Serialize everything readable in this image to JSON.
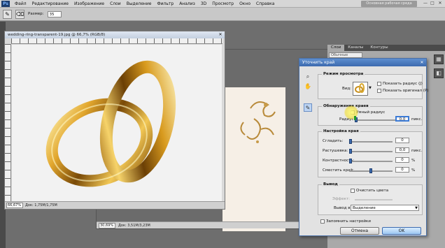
{
  "app": {
    "logo": "Ps",
    "menu": [
      "Файл",
      "Редактирование",
      "Изображение",
      "Слои",
      "Выделение",
      "Фильтр",
      "Анализ",
      "3D",
      "Просмотр",
      "Окно",
      "Справка"
    ],
    "workspace_button": "Основная рабочая среда",
    "window_controls": [
      "—",
      "□",
      "✕"
    ]
  },
  "options_bar": {
    "size_label": "Размер:",
    "size_value": "35"
  },
  "doc1": {
    "title": "wedding-ring-transparent-19.jpg @ 66,7% (RGB/8)",
    "zoom": "66,67%",
    "doc_size": "Док: 1,75M/1,75M"
  },
  "doc2": {
    "zoom": "30,69%",
    "doc_size": "Док: 3,51M/3,23M"
  },
  "right_panel": {
    "tabs": [
      "Слои",
      "Каналы",
      "Контуры"
    ],
    "blend_mode": "Обычные"
  },
  "dialog": {
    "title": "Уточнить край",
    "close": "✕",
    "view_mode": {
      "title": "Режим просмотра",
      "view_label": "Вид:",
      "show_radius": "Показать радиус (J)",
      "show_original": "Показать оригинал (P)"
    },
    "edge_detection": {
      "title": "Обнаружение краев",
      "smart_radius": "Умный радиус",
      "radius_label": "Радиус:",
      "radius_value": "0,0",
      "radius_unit": "пикс."
    },
    "adjust_edge": {
      "title": "Настройка края",
      "smooth_label": "Сгладить:",
      "smooth_value": "0",
      "feather_label": "Растушевка:",
      "feather_value": "0,0",
      "feather_unit": "пикс.",
      "contrast_label": "Контрастность:",
      "contrast_value": "0",
      "contrast_unit": "%",
      "shift_label": "Сместить край:",
      "shift_value": "0",
      "shift_unit": "%"
    },
    "output": {
      "title": "Вывод",
      "decontaminate": "Очистить цвета",
      "amount_label": "Эффект:",
      "output_to_label": "Вывод в:",
      "output_to_value": "Выделение"
    },
    "remember": "Запомнить настройки",
    "cancel": "Отмена",
    "ok": "OK"
  }
}
